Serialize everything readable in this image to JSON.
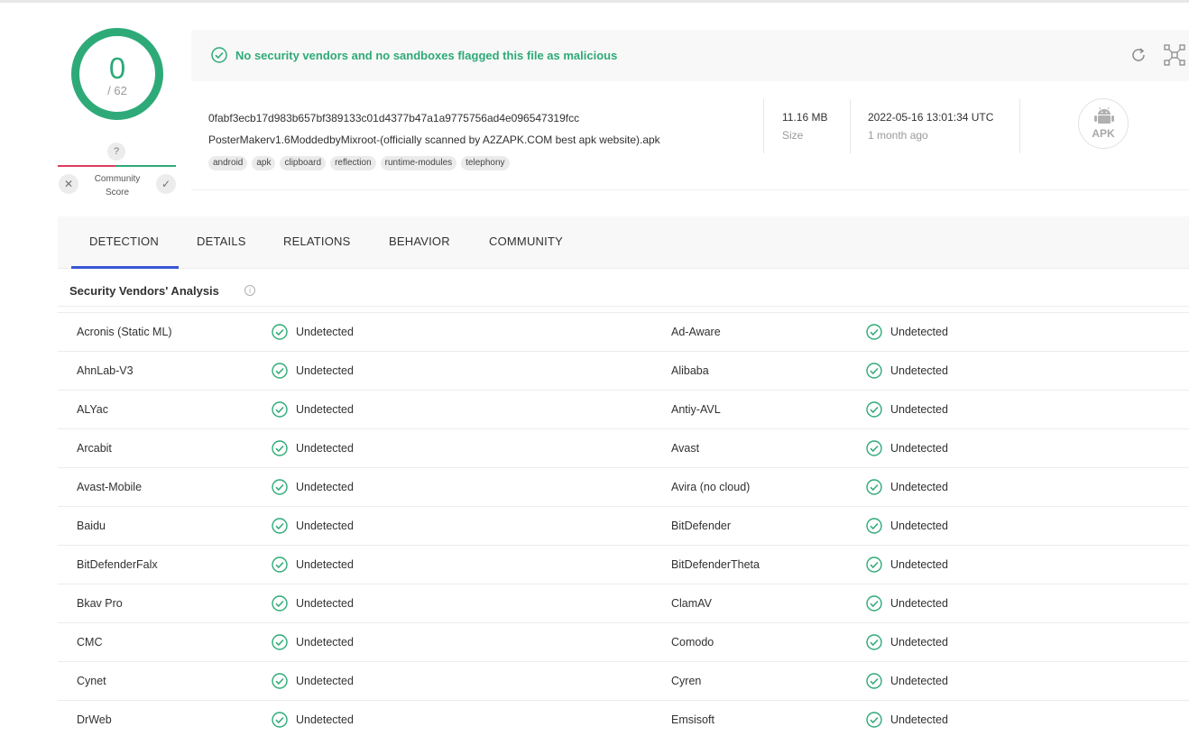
{
  "score": {
    "detections": "0",
    "total": "/ 62"
  },
  "community": {
    "question": "?",
    "label_line1": "Community",
    "label_line2": "Score",
    "dislike": "✕",
    "like": "✓"
  },
  "banner": {
    "message": "No security vendors and no sandboxes flagged this file as malicious"
  },
  "file": {
    "hash": "0fabf3ecb17d983b657bf389133c01d4377b47a1a9775756ad4e096547319fcc",
    "name": "PosterMakerv1.6ModdedbyMixroot-(officially scanned by A2ZAPK.COM best apk website).apk",
    "tags": [
      "android",
      "apk",
      "clipboard",
      "reflection",
      "runtime-modules",
      "telephony"
    ],
    "size_value": "11.16 MB",
    "size_label": "Size",
    "date_value": "2022-05-16 13:01:34 UTC",
    "date_label": "1 month ago",
    "type_badge": "APK"
  },
  "tabs": [
    "DETECTION",
    "DETAILS",
    "RELATIONS",
    "BEHAVIOR",
    "COMMUNITY"
  ],
  "active_tab": "DETECTION",
  "section": {
    "title": "Security Vendors' Analysis",
    "info": "i"
  },
  "colors": {
    "green": "#2eaa78",
    "red": "#dc3d5d",
    "accent": "#3a56d4"
  },
  "vendors": [
    {
      "left": "Acronis (Static ML)",
      "left_status": "Undetected",
      "right": "Ad-Aware",
      "right_status": "Undetected"
    },
    {
      "left": "AhnLab-V3",
      "left_status": "Undetected",
      "right": "Alibaba",
      "right_status": "Undetected"
    },
    {
      "left": "ALYac",
      "left_status": "Undetected",
      "right": "Antiy-AVL",
      "right_status": "Undetected"
    },
    {
      "left": "Arcabit",
      "left_status": "Undetected",
      "right": "Avast",
      "right_status": "Undetected"
    },
    {
      "left": "Avast-Mobile",
      "left_status": "Undetected",
      "right": "Avira (no cloud)",
      "right_status": "Undetected"
    },
    {
      "left": "Baidu",
      "left_status": "Undetected",
      "right": "BitDefender",
      "right_status": "Undetected"
    },
    {
      "left": "BitDefenderFalx",
      "left_status": "Undetected",
      "right": "BitDefenderTheta",
      "right_status": "Undetected"
    },
    {
      "left": "Bkav Pro",
      "left_status": "Undetected",
      "right": "ClamAV",
      "right_status": "Undetected"
    },
    {
      "left": "CMC",
      "left_status": "Undetected",
      "right": "Comodo",
      "right_status": "Undetected"
    },
    {
      "left": "Cynet",
      "left_status": "Undetected",
      "right": "Cyren",
      "right_status": "Undetected"
    },
    {
      "left": "DrWeb",
      "left_status": "Undetected",
      "right": "Emsisoft",
      "right_status": "Undetected"
    }
  ]
}
